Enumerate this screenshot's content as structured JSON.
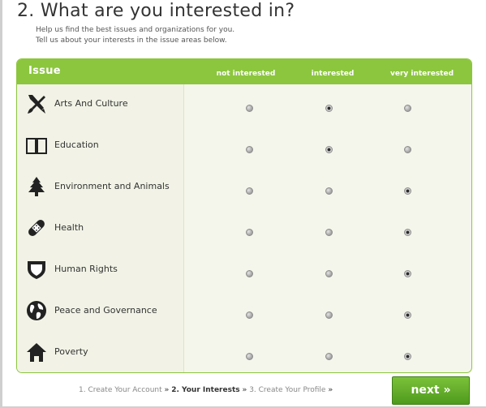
{
  "page": {
    "title": "2. What are you interested in?",
    "intro": [
      "Help us find the best issues and organizations for you.",
      "Tell us about your interests in the issue areas below."
    ]
  },
  "table": {
    "header": {
      "issue": "Issue",
      "columns": [
        "not interested",
        "interested",
        "very interested"
      ]
    },
    "rows": [
      {
        "label": "Arts And Culture",
        "icon": "art-brush-icon",
        "selected": "interested"
      },
      {
        "label": "Education",
        "icon": "open-book-icon",
        "selected": "interested"
      },
      {
        "label": "Environment and Animals",
        "icon": "pine-tree-icon",
        "selected": "very interested"
      },
      {
        "label": "Health",
        "icon": "bandage-icon",
        "selected": "very interested"
      },
      {
        "label": "Human Rights",
        "icon": "shield-icon",
        "selected": "very interested"
      },
      {
        "label": "Peace and Governance",
        "icon": "globe-icon",
        "selected": "very interested"
      },
      {
        "label": "Poverty",
        "icon": "house-icon",
        "selected": "very interested"
      }
    ]
  },
  "steps": {
    "step1": "1. Create Your Account",
    "sep1": "»",
    "step2": "2. Your Interests",
    "sep2": "»",
    "step3": "3. Create Your Profile",
    "sep3": "»"
  },
  "next_button": {
    "label": "next »"
  },
  "colors": {
    "accent_green": "#8cc63e",
    "button_green": "#5fa826",
    "table_bg": "#f5f6eb"
  }
}
